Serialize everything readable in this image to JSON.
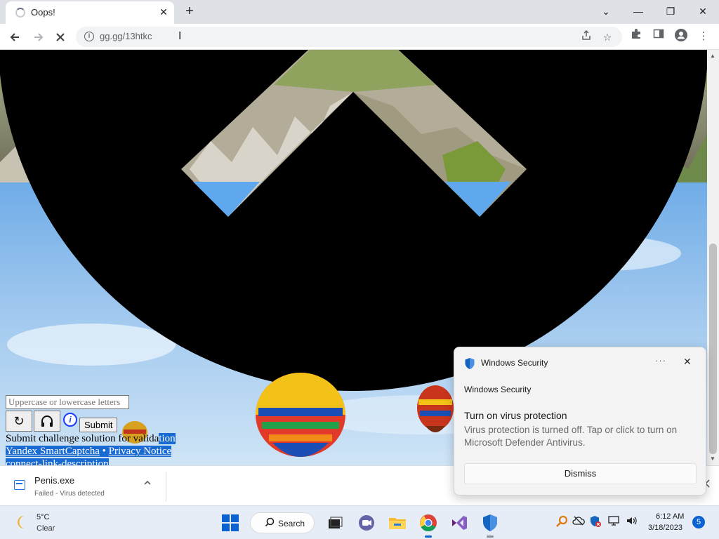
{
  "browser": {
    "tab_title": "Oops!",
    "tab_close_glyph": "✕",
    "new_tab_glyph": "+",
    "url": "gg.gg/13htkc",
    "window_controls": [
      "⌄",
      "—",
      "❐",
      "✕"
    ]
  },
  "page": {
    "captcha": {
      "input_placeholder": "Uppercase or lowercase letters",
      "refresh_glyph": "↻",
      "audio_glyph": "🎧",
      "info_glyph": "i",
      "submit_label": "Submit",
      "submit_caption_part1": "Submit challenge solution ",
      "submit_caption_part2": "for valida",
      "submit_caption_part3": "tion",
      "link_smartcaptcha": "Yandex SmartCaptcha",
      "link_separator": " • ",
      "link_privacy": "Privacy Notice",
      "connect_link": "connect-link-description"
    }
  },
  "download": {
    "file_name": "Penis.exe",
    "status": "Failed - Virus detected"
  },
  "toast": {
    "app_name": "Windows Security",
    "more_glyph": "···",
    "close_glyph": "✕",
    "subtitle": "Windows Security",
    "heading": "Turn on virus protection",
    "body": "Virus protection is turned off. Tap or click to turn on Microsoft Defender Antivirus.",
    "dismiss_label": "Dismiss"
  },
  "taskbar": {
    "weather_temp": "5°C",
    "weather_condition": "Clear",
    "search_label": "Search",
    "clock_time": "6:12 AM",
    "clock_date": "3/18/2023",
    "notification_count": "5",
    "apps": [
      "start-icon",
      "search-pill",
      "task-view-icon",
      "teams-icon",
      "file-explorer-icon",
      "chrome-icon",
      "visual-studio-icon",
      "defender-icon"
    ]
  },
  "colors": {
    "selection_blue": "#1a6bd1",
    "sky_blue": "#8ab9e6",
    "accent": "#0a63d0"
  }
}
